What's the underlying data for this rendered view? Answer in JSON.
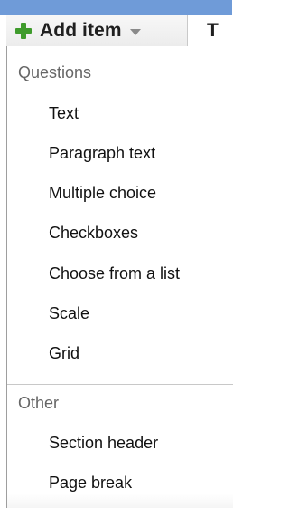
{
  "toolbar": {
    "add_item_label": "Add item",
    "next_label": "T"
  },
  "menu": {
    "sections": [
      {
        "heading": "Questions",
        "items": [
          "Text",
          "Paragraph text",
          "Multiple choice",
          "Checkboxes",
          "Choose from a list",
          "Scale",
          "Grid"
        ]
      },
      {
        "heading": "Other",
        "items": [
          "Section header",
          "Page break"
        ]
      }
    ]
  },
  "colors": {
    "accent_blue": "#6f9bd8",
    "plus_green": "#3f9b2c"
  },
  "icons": {
    "add": "plus-icon",
    "dropdown": "caret-down-icon"
  }
}
